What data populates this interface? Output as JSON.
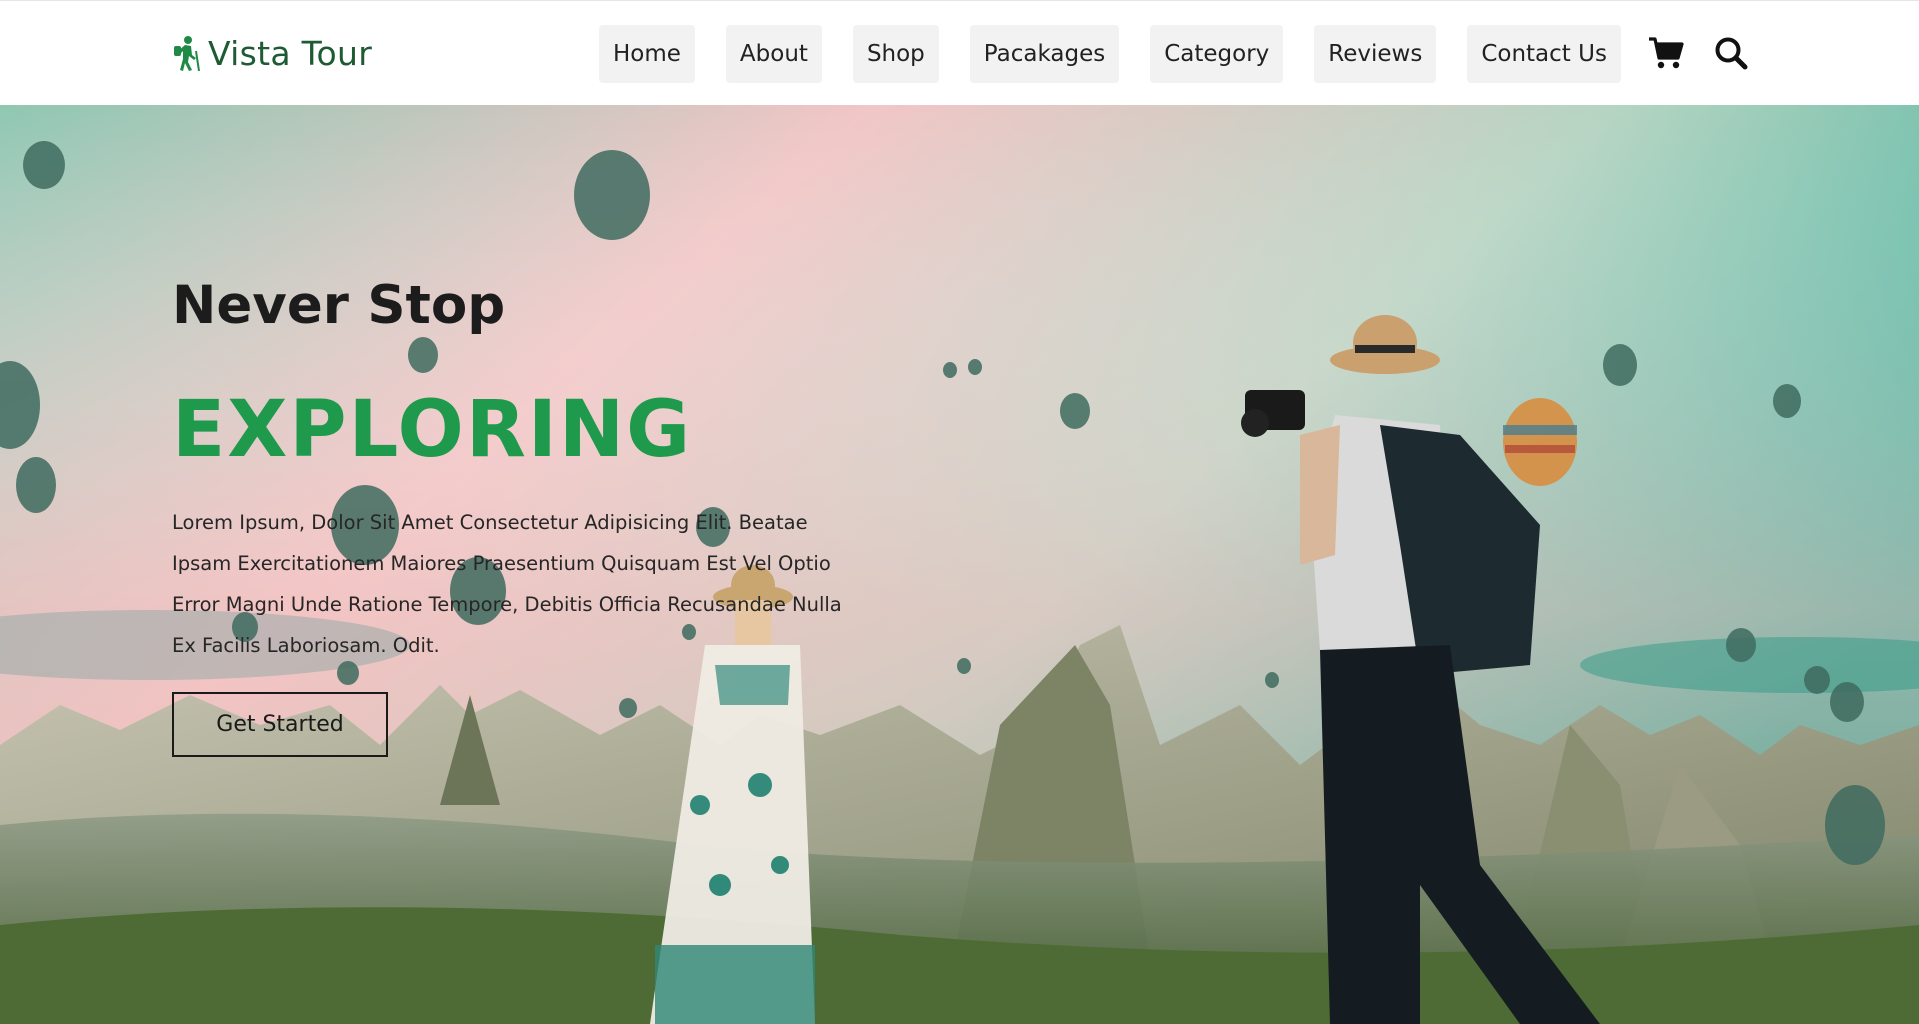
{
  "brand": {
    "name": "Vista Tour",
    "icon": "hiker-icon",
    "color": "#1e5a33"
  },
  "nav": {
    "items": [
      {
        "label": "Home"
      },
      {
        "label": "About"
      },
      {
        "label": "Shop"
      },
      {
        "label": "Pacakages"
      },
      {
        "label": "Category"
      },
      {
        "label": "Reviews"
      },
      {
        "label": "Contact Us"
      }
    ],
    "cart_icon": "shopping-cart-icon",
    "search_icon": "search-icon"
  },
  "hero": {
    "subtitle": "Never Stop",
    "title": "EXPLORING",
    "description": "Lorem Ipsum, Dolor Sit Amet Consectetur Adipisicing Elit. Beatae Ipsam Exercitationem Maiores Praesentium Quisquam Est Vel Optio Error Magni Unde Ratione Tempore, Debitis Officia Recusandae Nulla Ex Facilis Laboriosam. Odit.",
    "button_label": "Get Started",
    "accent_color": "#1f9a4c"
  }
}
